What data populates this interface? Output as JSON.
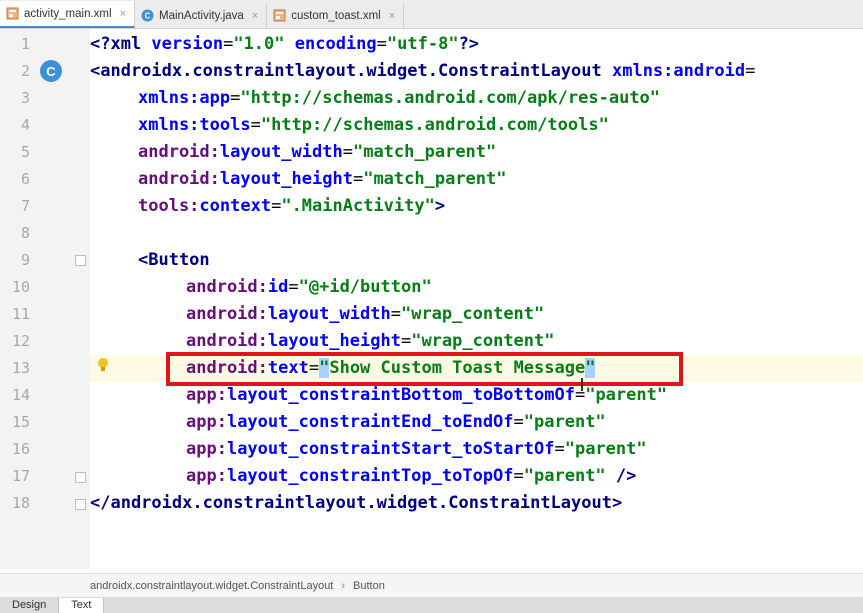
{
  "tabs": [
    {
      "label": "activity_main.xml",
      "icon": "xml-layout-icon",
      "active": true
    },
    {
      "label": "MainActivity.java",
      "icon": "class-c-icon",
      "active": false
    },
    {
      "label": "custom_toast.xml",
      "icon": "xml-layout-icon",
      "active": false
    }
  ],
  "line_numbers": [
    "1",
    "2",
    "3",
    "4",
    "5",
    "6",
    "7",
    "8",
    "9",
    "10",
    "11",
    "12",
    "13",
    "14",
    "15",
    "16",
    "17",
    "18"
  ],
  "code": {
    "l1": {
      "a": "<?xml ",
      "b": "version",
      "c": "=",
      "d": "\"1.0\"",
      "e": " ",
      "f": "encoding",
      "g": "=",
      "h": "\"utf-8\"",
      "i": "?>"
    },
    "l2": {
      "a": "<androidx.constraintlayout.widget.ConstraintLayout ",
      "b": "xmlns:",
      "c": "android",
      "d": "="
    },
    "l3": {
      "a": "xmlns:",
      "b": "app",
      "c": "=",
      "d": "\"http://schemas.android.com/apk/res-auto\""
    },
    "l4": {
      "a": "xmlns:",
      "b": "tools",
      "c": "=",
      "d": "\"http://schemas.android.com/tools\""
    },
    "l5": {
      "a": "android:",
      "b": "layout_width",
      "c": "=",
      "d": "\"match_parent\""
    },
    "l6": {
      "a": "android:",
      "b": "layout_height",
      "c": "=",
      "d": "\"match_parent\""
    },
    "l7": {
      "a": "tools:",
      "b": "context",
      "c": "=",
      "d": "\".MainActivity\"",
      "e": ">"
    },
    "l9": {
      "a": "<Button"
    },
    "l10": {
      "a": "android:",
      "b": "id",
      "c": "=",
      "d": "\"@+id/button\""
    },
    "l11": {
      "a": "android:",
      "b": "layout_width",
      "c": "=",
      "d": "\"wrap_content\""
    },
    "l12": {
      "a": "android:",
      "b": "layout_height",
      "c": "=",
      "d": "\"wrap_content\""
    },
    "l13": {
      "a": "android:",
      "b": "text",
      "c": "=",
      "d1": "\"",
      "d2": "Show Custom Toast Message",
      "d3": "\""
    },
    "l14": {
      "a": "app:",
      "b": "layout_constraintBottom_toBottomOf",
      "c": "=",
      "d": "\"parent\""
    },
    "l15": {
      "a": "app:",
      "b": "layout_constraintEnd_toEndOf",
      "c": "=",
      "d": "\"parent\""
    },
    "l16": {
      "a": "app:",
      "b": "layout_constraintStart_toStartOf",
      "c": "=",
      "d": "\"parent\""
    },
    "l17": {
      "a": "app:",
      "b": "layout_constraintTop_toTopOf",
      "c": "=",
      "d": "\"parent\"",
      "e": " />"
    },
    "l18": {
      "a": "</androidx.constraintlayout.widget.ConstraintLayout>"
    }
  },
  "gutter_class_badge": "C",
  "breadcrumb": {
    "item1": "androidx.constraintlayout.widget.ConstraintLayout",
    "separator": "›",
    "item2": "Button"
  },
  "bottom_tabs": {
    "design": "Design",
    "text": "Text"
  },
  "colors": {
    "tag": "#000080",
    "attr": "#0000ff",
    "value": "#067d17",
    "namespace": "#660e7a",
    "highlight_box": "#e0141b"
  }
}
